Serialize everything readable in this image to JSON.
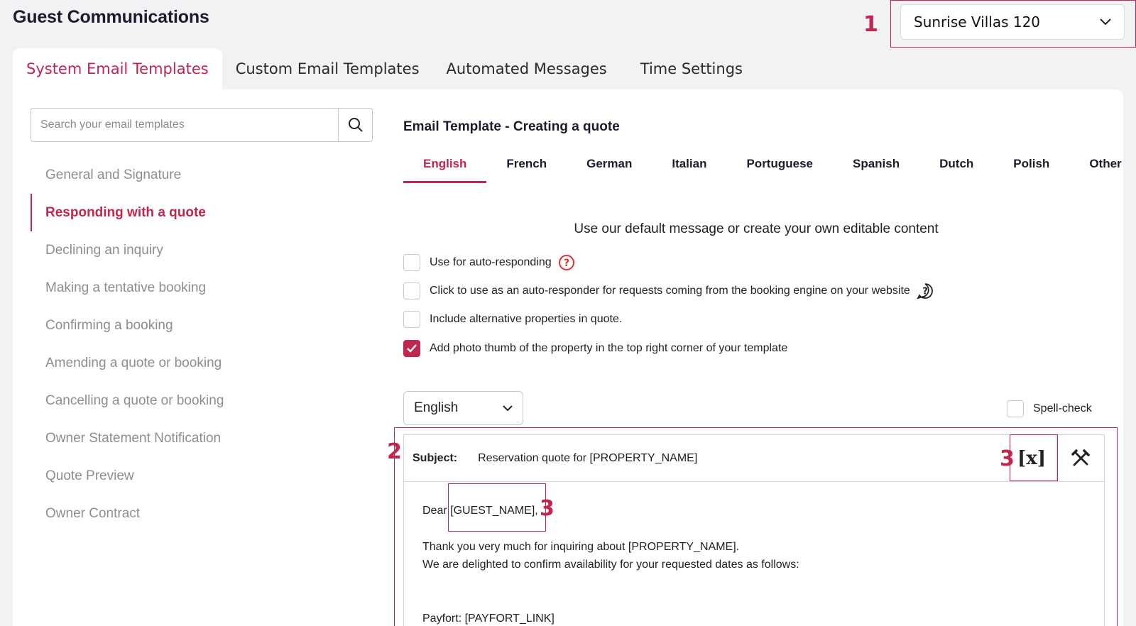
{
  "header": {
    "title": "Guest Communications"
  },
  "property_selector": {
    "value": "Sunrise Villas 120"
  },
  "tabs": [
    {
      "label": "System Email Templates",
      "active": true
    },
    {
      "label": "Custom Email Templates"
    },
    {
      "label": "Automated Messages"
    },
    {
      "label": "Time Settings"
    }
  ],
  "search": {
    "placeholder": "Search your email templates"
  },
  "sidebar": {
    "items": [
      {
        "label": "General and Signature"
      },
      {
        "label": "Responding with a quote",
        "active": true
      },
      {
        "label": "Declining an inquiry"
      },
      {
        "label": "Making a tentative booking"
      },
      {
        "label": "Confirming a booking"
      },
      {
        "label": "Amending a quote or booking"
      },
      {
        "label": "Cancelling a quote or booking"
      },
      {
        "label": "Owner Statement Notification"
      },
      {
        "label": "Quote Preview"
      },
      {
        "label": "Owner Contract"
      }
    ]
  },
  "template": {
    "title": "Email Template - Creating a quote",
    "languages": [
      "English",
      "French",
      "German",
      "Italian",
      "Portuguese",
      "Spanish",
      "Dutch",
      "Polish",
      "Other"
    ],
    "active_language": "English",
    "default_message": "Use our default message or create your own editable content",
    "options": [
      {
        "label": "Use for auto-responding",
        "checked": false
      },
      {
        "label": "Click to use as an auto-responder for requests coming from the booking engine on your website",
        "checked": false
      },
      {
        "label": "Include alternative properties in quote.",
        "checked": false
      },
      {
        "label": "Add photo thumb of the property in the top right corner of your template",
        "checked": true
      }
    ],
    "language_select": "English",
    "spell_check": {
      "label": "Spell-check",
      "checked": false
    }
  },
  "editor": {
    "subject_label": "Subject:",
    "subject_value": "Reservation quote for [PROPERTY_NAME]",
    "variable_button": "[x]",
    "body": {
      "greeting": "Dear ",
      "guest_var": "[GUEST_NAME],",
      "line1": "Thank you very much for inquiring about [PROPERTY_NAME].",
      "line2": "We are delighted to confirm availability for your requested dates as follows:",
      "line3": "Payfort: [PAYFORT_LINK]"
    }
  },
  "annotations": [
    "1",
    "2",
    "3",
    "3"
  ],
  "colors": {
    "accent": "#c0264e",
    "panel": "#ffffff",
    "background": "#f2f2f4"
  }
}
